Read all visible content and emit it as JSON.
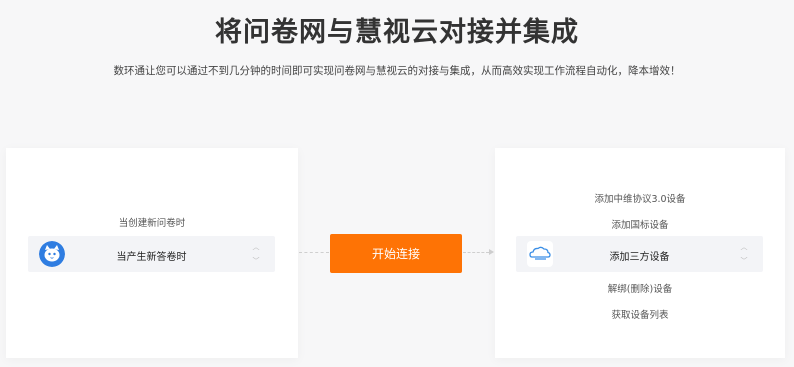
{
  "header": {
    "title": "将问卷网与慧视云对接并集成",
    "subtitle": "数环通让您可以通过不到几分钟的时间即可实现问卷网与慧视云的对接与集成，从而高效实现工作流程自动化，降本增效！"
  },
  "left_card": {
    "option_above": "当创建新问卷时",
    "selected_label": "当产生新答卷时",
    "icon": "wenjuan-cat-icon"
  },
  "connect_button": {
    "label": "开始连接"
  },
  "right_card": {
    "options_above": [
      "添加中维协议3.0设备",
      "添加国标设备"
    ],
    "selected_label": "添加三方设备",
    "options_below": [
      "解绑(删除)设备",
      "获取设备列表"
    ],
    "icon": "huishiyun-cloud-icon"
  },
  "colors": {
    "accent": "#fe7305",
    "background": "#f7f7f8"
  }
}
